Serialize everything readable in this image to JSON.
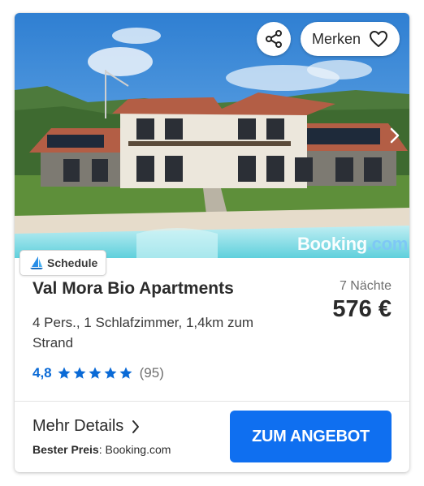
{
  "listing": {
    "title": "Val Mora Bio Apartments",
    "description": "4 Pers., 1 Schlafzimmer, 1,4km zum Strand",
    "nights_label": "7 Nächte",
    "price": "576 €",
    "rating": {
      "score": "4,8",
      "stars": 5,
      "count": "(95)"
    }
  },
  "image": {
    "watermark_brand": "Booking",
    "watermark_tld": ".com"
  },
  "actions": {
    "merken_label": "Merken",
    "details_label": "Mehr Details",
    "cta_label": "ZUM ANGEBOT"
  },
  "badge": {
    "label": "Schedule"
  },
  "best_price": {
    "label": "Bester Preis",
    "separator": ":",
    "provider": "Booking.com"
  },
  "colors": {
    "accent_blue": "#0f6ff0",
    "rating_blue": "#0a6ad6",
    "watermark_tld": "#7ec8f5"
  },
  "icons": {
    "share": "share-icon",
    "heart": "heart-icon",
    "next": "chevron-right-icon",
    "details": "chevron-right-icon",
    "star": "star-icon",
    "schedule": "sail-logo-icon"
  }
}
